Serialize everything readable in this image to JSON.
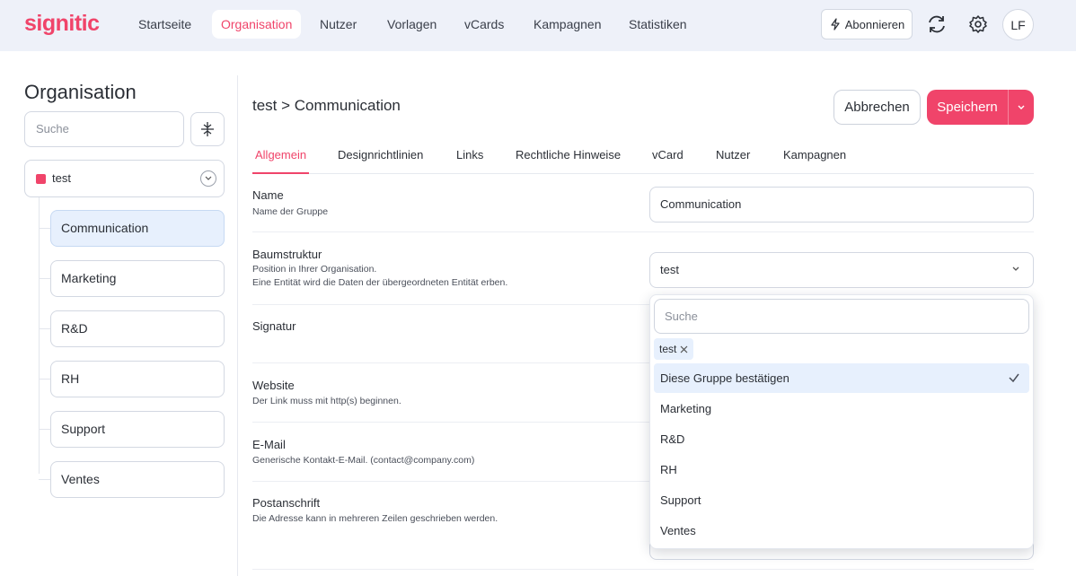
{
  "brand": {
    "logo": "signitic",
    "accent": "#f0446a"
  },
  "nav": {
    "items": [
      {
        "label": "Startseite"
      },
      {
        "label": "Organisation"
      },
      {
        "label": "Nutzer"
      },
      {
        "label": "Vorlagen"
      },
      {
        "label": "vCards"
      },
      {
        "label": "Kampagnen"
      },
      {
        "label": "Statistiken"
      }
    ],
    "active": "Organisation",
    "subscribe_label": "Abonnieren",
    "avatar_initials": "LF"
  },
  "sidebar": {
    "title": "Organisation",
    "search_placeholder": "Suche",
    "root": {
      "label": "test"
    },
    "children": [
      {
        "label": "Communication"
      },
      {
        "label": "Marketing"
      },
      {
        "label": "R&D"
      },
      {
        "label": "RH"
      },
      {
        "label": "Support"
      },
      {
        "label": "Ventes"
      }
    ],
    "selected": "Communication"
  },
  "main": {
    "breadcrumb": "test > Communication",
    "cancel_label": "Abbrechen",
    "save_label": "Speichern",
    "tabs": [
      {
        "label": "Allgemein"
      },
      {
        "label": "Designrichtlinien"
      },
      {
        "label": "Links"
      },
      {
        "label": "Rechtliche Hinweise"
      },
      {
        "label": "vCard"
      },
      {
        "label": "Nutzer"
      },
      {
        "label": "Kampagnen"
      }
    ],
    "active_tab": "Allgemein",
    "fields": {
      "name": {
        "label": "Name",
        "help": "Name der Gruppe",
        "value": "Communication"
      },
      "tree": {
        "label": "Baumstruktur",
        "help1": "Position in Ihrer Organisation.",
        "help2": "Eine Entität wird die Daten der übergeordneten Entität erben.",
        "value": "test"
      },
      "signature": {
        "label": "Signatur"
      },
      "website": {
        "label": "Website",
        "help": "Der Link muss mit http(s) beginnen."
      },
      "email": {
        "label": "E-Mail",
        "help": "Generische Kontakt-E-Mail. (contact@company.com)"
      },
      "address": {
        "label": "Postanschrift",
        "help": "Die Adresse kann in mehreren Zeilen geschrieben werden."
      }
    }
  },
  "dropdown": {
    "search_placeholder": "Suche",
    "chip": "test",
    "options": [
      {
        "label": "Diese Gruppe bestätigen"
      },
      {
        "label": "Marketing"
      },
      {
        "label": "R&D"
      },
      {
        "label": "RH"
      },
      {
        "label": "Support"
      },
      {
        "label": "Ventes"
      }
    ]
  }
}
